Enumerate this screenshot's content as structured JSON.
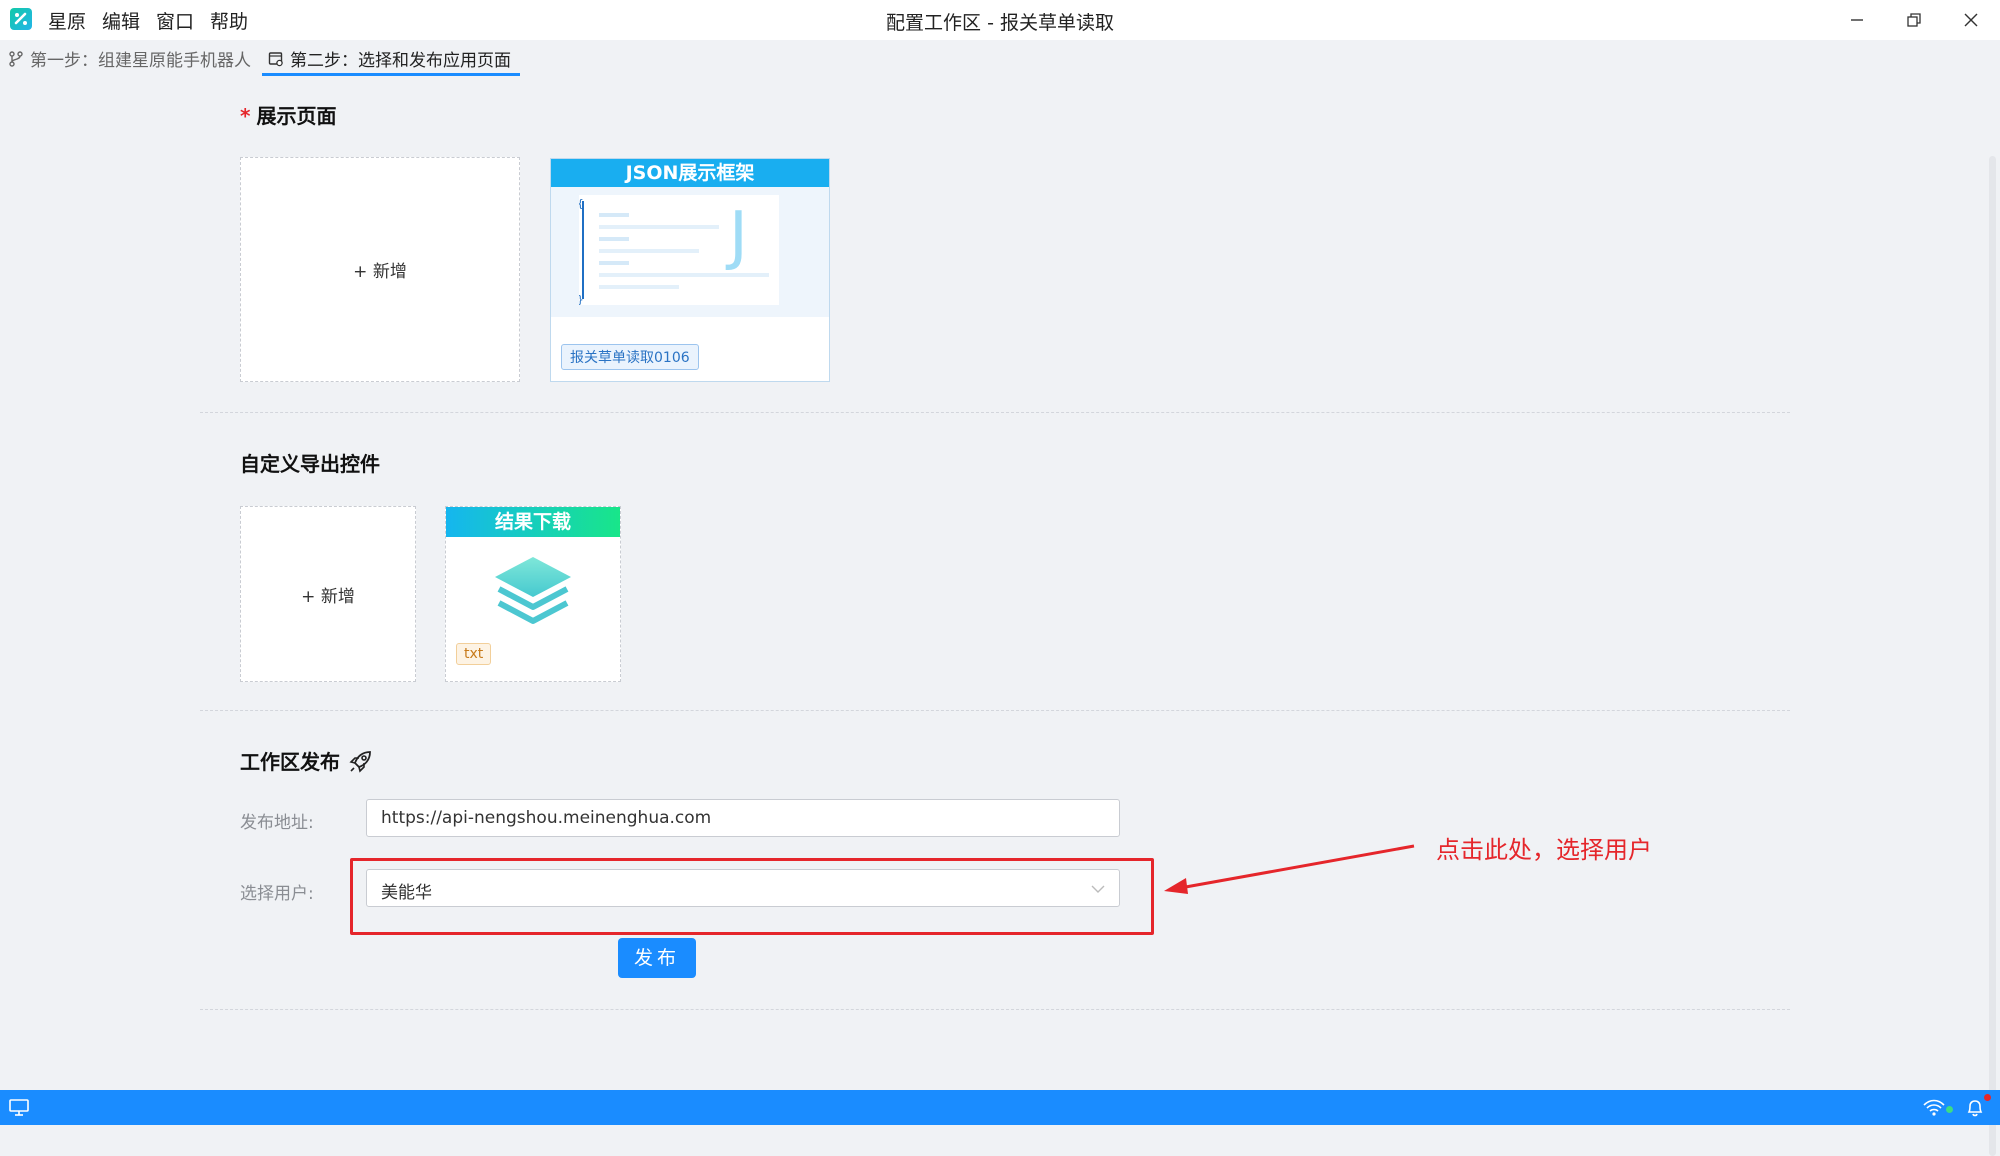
{
  "window": {
    "title": "配置工作区 - 报关草单读取",
    "menu": [
      "星原",
      "编辑",
      "窗口",
      "帮助"
    ]
  },
  "tabs": [
    {
      "label": "第一步：组建星原能手机器人",
      "icon": "branch-icon"
    },
    {
      "label": "第二步：选择和发布应用页面",
      "icon": "page-settings-icon",
      "active": true
    }
  ],
  "display_pages": {
    "title": "展示页面",
    "required_mark": "*",
    "add_label": "+ 新增",
    "card": {
      "header": "JSON展示框架",
      "tag": "报关草单读取0106"
    }
  },
  "export_controls": {
    "title": "自定义导出控件",
    "add_label": "+ 新增",
    "card": {
      "header": "结果下载",
      "tag": "txt"
    }
  },
  "publish": {
    "title": "工作区发布",
    "title_icon": "rocket-icon",
    "address_label": "发布地址:",
    "address_value": "https://api-nengshou.meinenghua.com",
    "user_label": "选择用户:",
    "user_value": "美能华",
    "button_label": "发布"
  },
  "annotation": {
    "text": "点击此处，选择用户",
    "color": "#e5262b"
  },
  "colors": {
    "accent": "#1a8cff",
    "status_bar": "#1a8cff",
    "highlight": "#e5262b"
  }
}
